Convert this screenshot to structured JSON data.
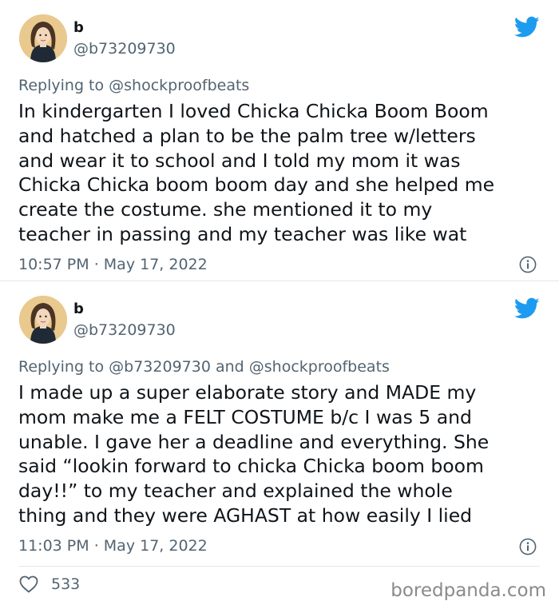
{
  "colors": {
    "accent": "#1d9bf0",
    "text": "#0f1419",
    "muted": "#536471",
    "divider": "#e1e8ed"
  },
  "tweets": [
    {
      "author": {
        "name": "b",
        "handle": "@b73209730"
      },
      "replying_prefix": "Replying to ",
      "replying_to": [
        "@shockproofbeats"
      ],
      "replying_joiner": "",
      "lines": [
        "In kindergarten I loved Chicka Chicka Boom Boom",
        "and hatched a plan to be the palm tree w/letters",
        "and wear it to school and I told my mom it was",
        "Chicka Chicka boom boom day and she helped me",
        "create the costume. she mentioned it to my",
        "teacher in passing and my teacher was like wat"
      ],
      "time": "10:57 PM",
      "date": "May 17, 2022",
      "dot": " · "
    },
    {
      "author": {
        "name": "b",
        "handle": "@b73209730"
      },
      "replying_prefix": "Replying to ",
      "replying_to": [
        "@b73209730",
        "@shockproofbeats"
      ],
      "replying_joiner": " and ",
      "lines": [
        "I made up a super elaborate story and MADE my",
        "mom make me a FELT COSTUME b/c I was 5  and",
        "unable. I gave her a deadline and everything. She",
        "said “lookin forward to chicka Chicka boom boom",
        "day!!” to my teacher and explained the whole",
        "thing and they were AGHAST at how easily I lied"
      ],
      "time": "11:03 PM",
      "date": "May 17, 2022",
      "dot": " · "
    }
  ],
  "likes": {
    "count": "533",
    "icon": "heart-icon"
  },
  "watermark": "boredpanda.com",
  "icons": {
    "platform": "twitter-bird-icon",
    "info": "info-icon"
  }
}
